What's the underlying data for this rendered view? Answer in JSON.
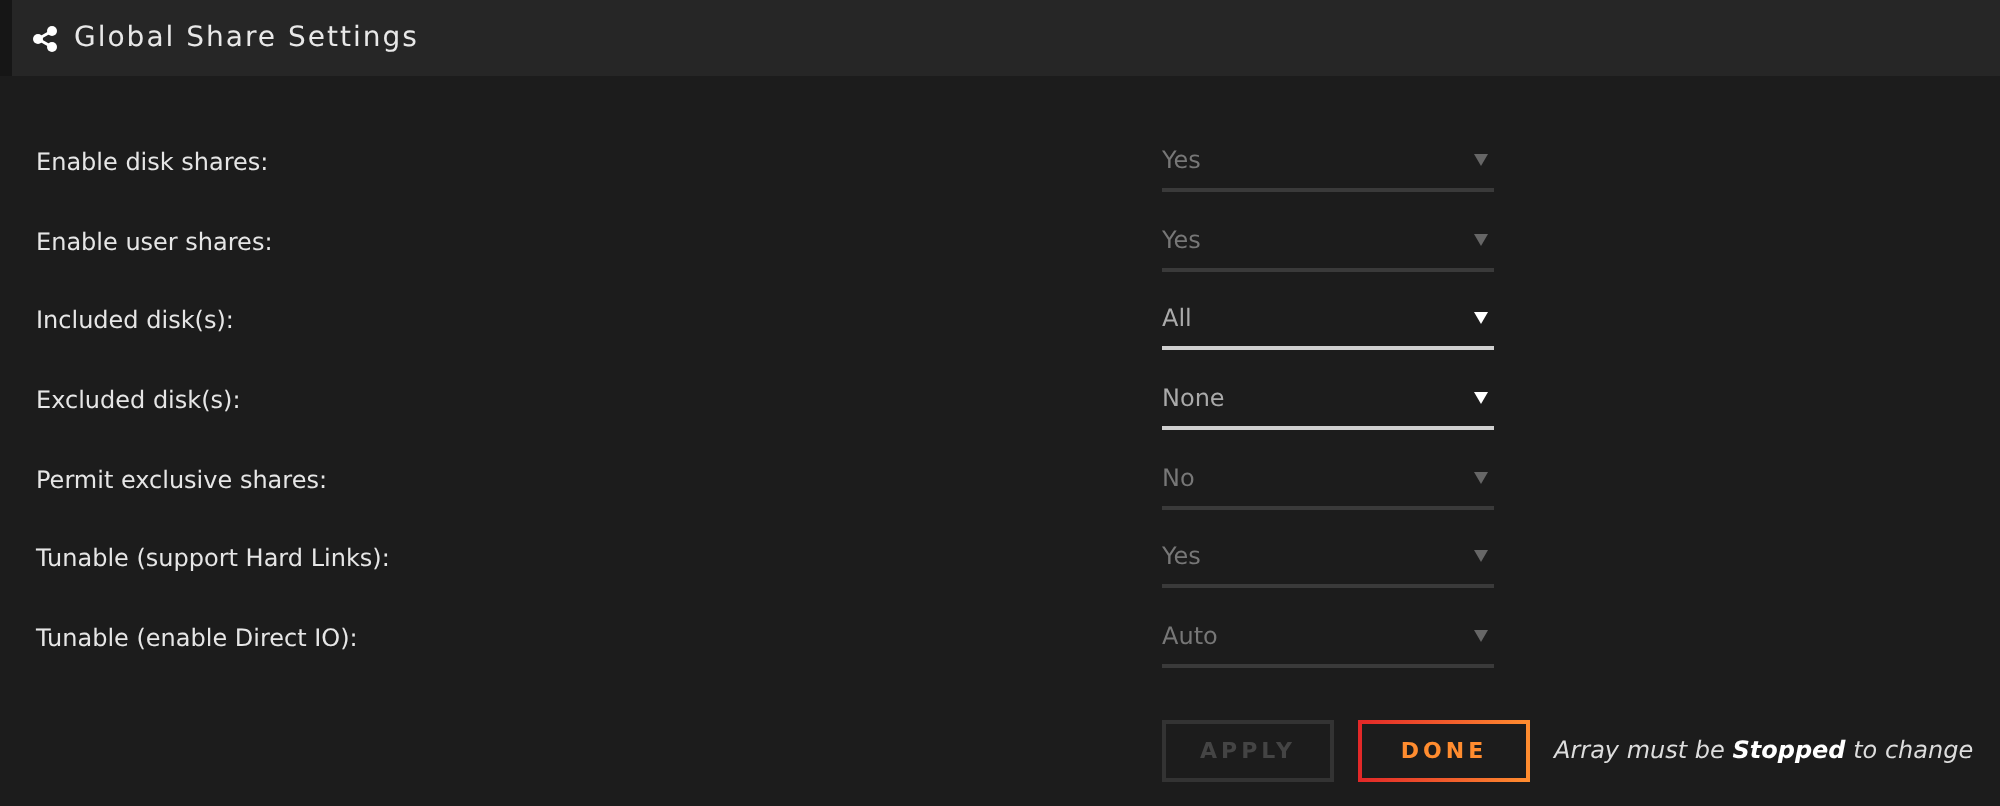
{
  "header": {
    "title": "Global Share Settings"
  },
  "settings": [
    {
      "label": "Enable disk shares:",
      "value": "Yes",
      "disabled": true
    },
    {
      "label": "Enable user shares:",
      "value": "Yes",
      "disabled": true
    },
    {
      "label": "Included disk(s):",
      "value": "All",
      "disabled": false
    },
    {
      "label": "Excluded disk(s):",
      "value": "None",
      "disabled": false
    },
    {
      "label": "Permit exclusive shares:",
      "value": "No",
      "disabled": true
    },
    {
      "label": "Tunable (support Hard Links):",
      "value": "Yes",
      "disabled": true
    },
    {
      "label": "Tunable (enable Direct IO):",
      "value": "Auto",
      "disabled": true
    }
  ],
  "buttons": [
    {
      "label": "APPLY",
      "disabled": true
    },
    {
      "label": "DONE",
      "disabled": false
    }
  ],
  "note": "Array must be **Stopped** to change"
}
